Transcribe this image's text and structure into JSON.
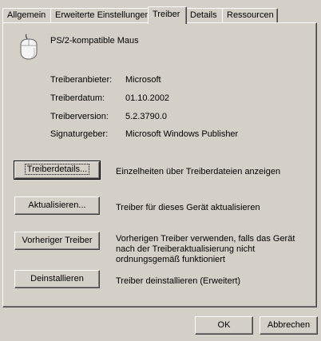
{
  "tabs": [
    {
      "label": "Allgemein",
      "active": false
    },
    {
      "label": "Erweiterte Einstellungen",
      "active": false
    },
    {
      "label": "Treiber",
      "active": true
    },
    {
      "label": "Details",
      "active": false
    },
    {
      "label": "Ressourcen",
      "active": false
    }
  ],
  "device": {
    "icon": "mouse-icon",
    "name": "PS/2-kompatible Maus"
  },
  "info": {
    "provider_label": "Treiberanbieter:",
    "provider_value": "Microsoft",
    "date_label": "Treiberdatum:",
    "date_value": "01.10.2002",
    "version_label": "Treiberversion:",
    "version_value": "5.2.3790.0",
    "signer_label": "Signaturgeber:",
    "signer_value": "Microsoft Windows Publisher"
  },
  "actions": {
    "details_label": "Treiberdetails...",
    "details_desc": "Einzelheiten über Treiberdateien anzeigen",
    "update_label": "Aktualisieren...",
    "update_desc": "Treiber für dieses Gerät aktualisieren",
    "rollback_label": "Vorheriger Treiber",
    "rollback_desc": "Vorherigen Treiber verwenden, falls das Gerät nach der Treiberaktualisierung nicht ordnungsgemäß funktioniert",
    "uninstall_label": "Deinstallieren",
    "uninstall_desc": "Treiber deinstallieren (Erweitert)"
  },
  "footer": {
    "ok_label": "OK",
    "cancel_label": "Abbrechen"
  },
  "colors": {
    "window_bg": "#d4d0c8",
    "highlight": "#ffffff",
    "shadow": "#808080",
    "dark_shadow": "#404040"
  }
}
